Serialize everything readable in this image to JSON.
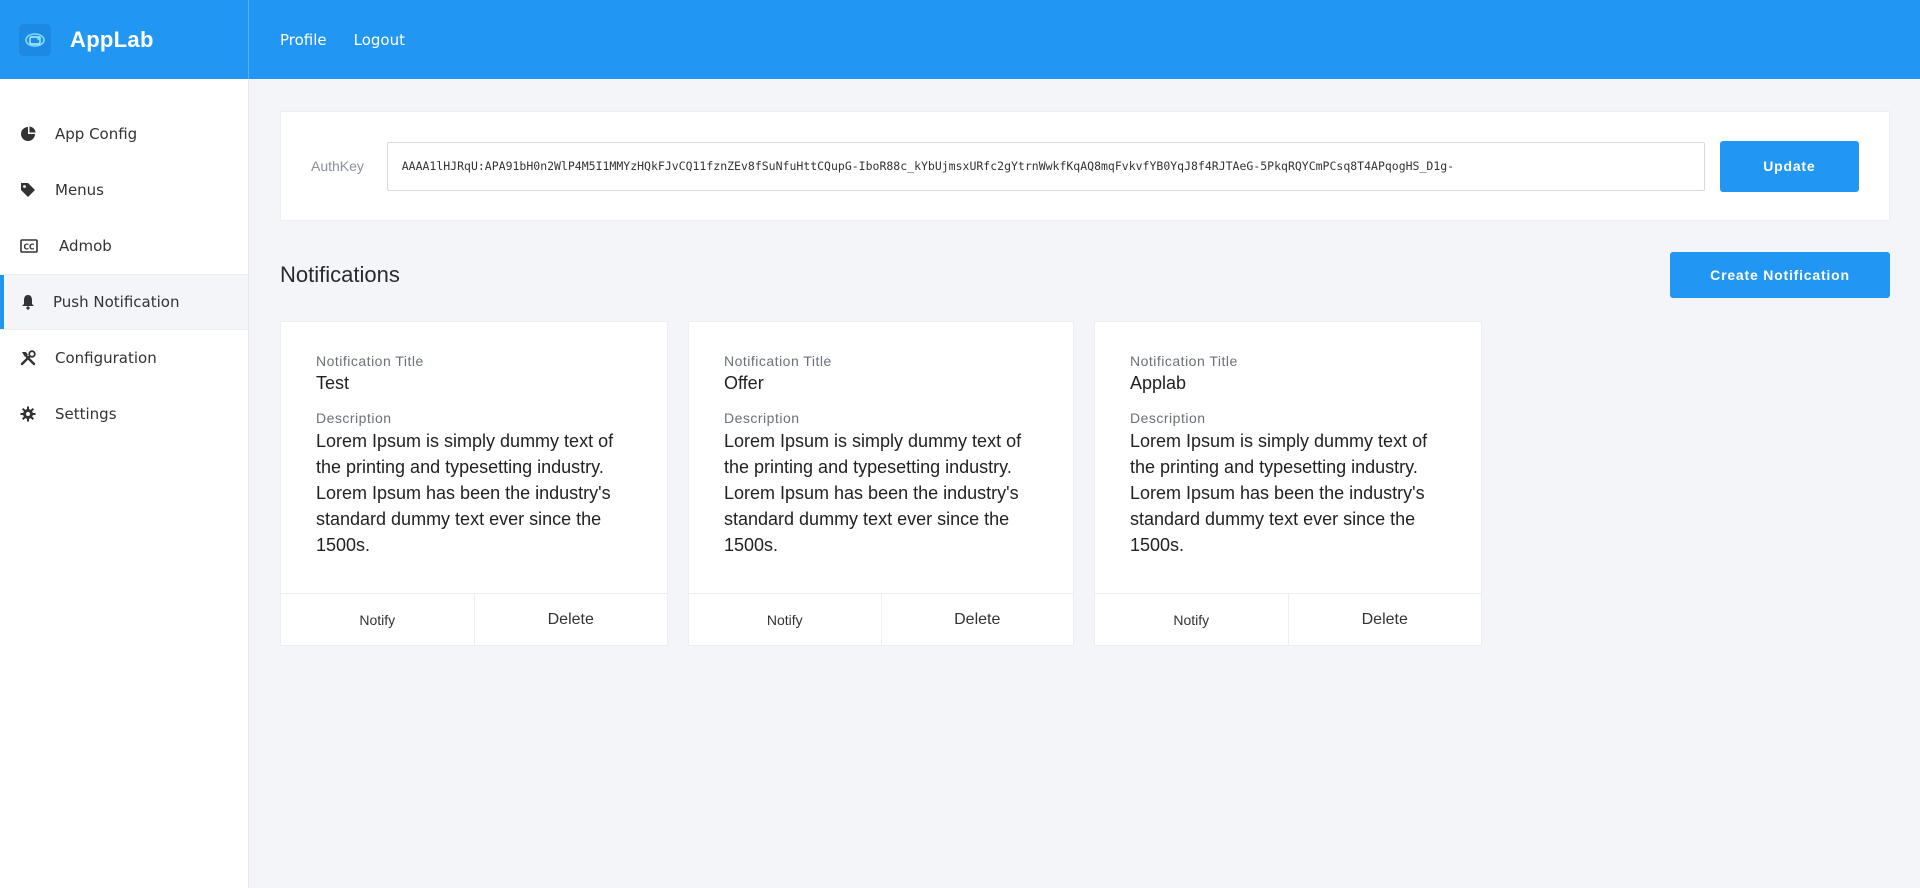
{
  "app": {
    "name": "AppLab"
  },
  "topnav": {
    "profile": "Profile",
    "logout": "Logout"
  },
  "sidebar": {
    "items": [
      {
        "label": "App Config",
        "icon": "pie-chart-icon"
      },
      {
        "label": "Menus",
        "icon": "tag-icon"
      },
      {
        "label": "Admob",
        "icon": "cc-icon"
      },
      {
        "label": "Push Notification",
        "icon": "bell-icon",
        "active": true
      },
      {
        "label": "Configuration",
        "icon": "tools-icon"
      },
      {
        "label": "Settings",
        "icon": "gear-icon"
      }
    ]
  },
  "auth": {
    "label": "AuthKey",
    "value": "AAAA1lHJRqU:APA91bH0n2WlP4M5I1MMYzHQkFJvCQ11fznZEv8fSuNfuHttCQupG-IboR88c_kYbUjmsxURfc2gYtrnWwkfKqAQ8mqFvkvfYB0YqJ8f4RJTAeG-5PkqRQYCmPCsq8T4APqogHS_D1g-",
    "update_label": "Update"
  },
  "notifications": {
    "heading": "Notifications",
    "create_label": "Create Notification",
    "title_label": "Notification Title",
    "desc_label": "Description",
    "notify_label": "Notify",
    "delete_label": "Delete",
    "items": [
      {
        "title": "Test",
        "description": "Lorem Ipsum is simply dummy text of the printing and typesetting industry. Lorem Ipsum has been the industry's standard dummy text ever since the 1500s."
      },
      {
        "title": "Offer",
        "description": "Lorem Ipsum is simply dummy text of the printing and typesetting industry. Lorem Ipsum has been the industry's standard dummy text ever since the 1500s."
      },
      {
        "title": "Applab",
        "description": "Lorem Ipsum is simply dummy text of the printing and typesetting industry. Lorem Ipsum has been the industry's standard dummy text ever since the 1500s."
      }
    ]
  },
  "colors": {
    "primary": "#2196f3",
    "background": "#f4f5f8"
  }
}
